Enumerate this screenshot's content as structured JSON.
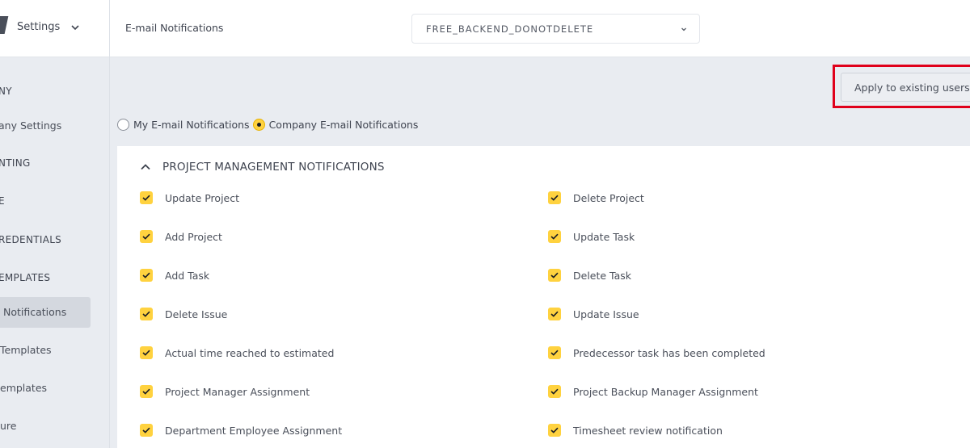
{
  "sidebar": {
    "title": "Settings",
    "sections": [
      {
        "label": "NY"
      },
      {
        "label": "any Settings"
      },
      {
        "label": "NTING"
      },
      {
        "label": "E"
      },
      {
        "label": "REDENTIALS"
      },
      {
        "label": "EMPLATES"
      },
      {
        "label": "Notifications"
      },
      {
        "label": "Templates"
      },
      {
        "label": "emplates"
      },
      {
        "label": "ure"
      }
    ]
  },
  "topbar": {
    "title": "E-mail Notifications",
    "select_value": "FREE_BACKEND_DONOTDELETE"
  },
  "apply_button": "Apply to existing users",
  "radios": {
    "my": "My E-mail Notifications",
    "company": "Company E-mail Notifications",
    "selected": "company"
  },
  "panel": {
    "title": "PROJECT MANAGEMENT NOTIFICATIONS",
    "left_items": [
      "Update Project",
      "Add Project",
      "Add Task",
      "Delete Issue",
      "Actual time reached to estimated",
      "Project Manager Assignment",
      "Department Employee Assignment"
    ],
    "right_items": [
      "Delete Project",
      "Update Task",
      "Delete Task",
      "Update Issue",
      "Predecessor task has been completed",
      "Project Backup Manager Assignment",
      "Timesheet review notification"
    ]
  },
  "colors": {
    "accent": "#ffd23f",
    "highlight": "#e0001b"
  }
}
